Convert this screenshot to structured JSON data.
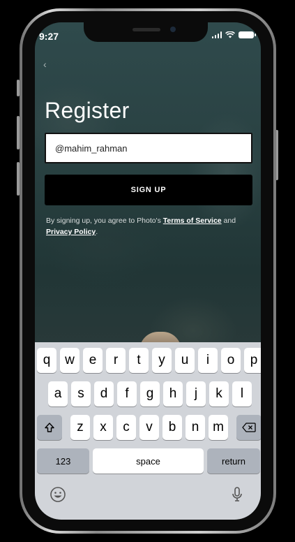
{
  "status": {
    "time": "9:27"
  },
  "register": {
    "title": "Register",
    "username_value": "@mahim_rahman",
    "signup_label": "SIGN UP",
    "terms_prefix": "By signing up, you agree to Photo's ",
    "terms_link": "Terms of Service",
    "terms_and": " and",
    "privacy_link": "Privacy Policy",
    "terms_suffix": "."
  },
  "keyboard": {
    "row1": [
      "q",
      "w",
      "e",
      "r",
      "t",
      "y",
      "u",
      "i",
      "o",
      "p"
    ],
    "row2": [
      "a",
      "s",
      "d",
      "f",
      "g",
      "h",
      "j",
      "k",
      "l"
    ],
    "row3": [
      "z",
      "x",
      "c",
      "v",
      "b",
      "n",
      "m"
    ],
    "numbers_label": "123",
    "space_label": "space",
    "return_label": "return"
  },
  "icons": {
    "back": "chevron-left-icon",
    "shift": "shift-icon",
    "delete": "backspace-icon",
    "emoji": "emoji-icon",
    "mic": "microphone-icon"
  },
  "colors": {
    "button": "#000000",
    "keyboard_bg": "#d1d4d9",
    "dark_key": "#adb3bc"
  }
}
